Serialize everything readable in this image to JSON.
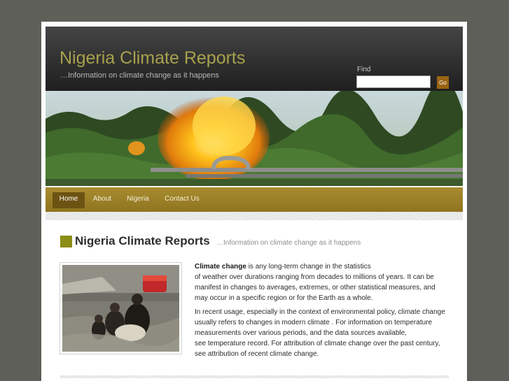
{
  "header": {
    "site_title": "Nigeria Climate Reports",
    "tagline": "…Information on climate change as it happens",
    "search": {
      "label": "Find",
      "placeholder": "",
      "value": "",
      "button_label": "Go"
    }
  },
  "banner": {
    "image": "gas flare fire above pipelines with green forest"
  },
  "nav": {
    "items": [
      {
        "label": "Home",
        "active": true
      },
      {
        "label": "About",
        "active": false
      },
      {
        "label": "Nigeria",
        "active": false
      },
      {
        "label": "Contact Us",
        "active": false
      }
    ]
  },
  "content": {
    "title": "Nigeria Climate Reports",
    "subtitle": "…Information on climate change as it happens",
    "photo": "people wading through flood water carrying belongings",
    "p1_bold": "Climate change",
    "p1_line1": " is any long-term change in the statistics",
    "p1_line2": "of weather over durations ranging from decades to millions of years. It can be",
    "p1_line3": "manifest in changes to averages, extremes, or other statistical measures, and",
    "p1_line4": "may occur in a specific region or for the Earth as a whole.",
    "p2_line1": "In recent usage, especially in the context of environmental policy, climate change",
    "p2_line2": "usually refers to changes in modern climate . For information on temperature",
    "p2_line3": "measurements over various periods, and the data sources available,",
    "p2_line4": "see temperature record. For attribution of climate change over the past century,",
    "p2_line5": "see attribution of recent climate change."
  },
  "colors": {
    "accent_olive": "#a8a14c",
    "nav_gold": "#9c8027",
    "go_button": "#9a6413",
    "square": "#8c8d17"
  }
}
